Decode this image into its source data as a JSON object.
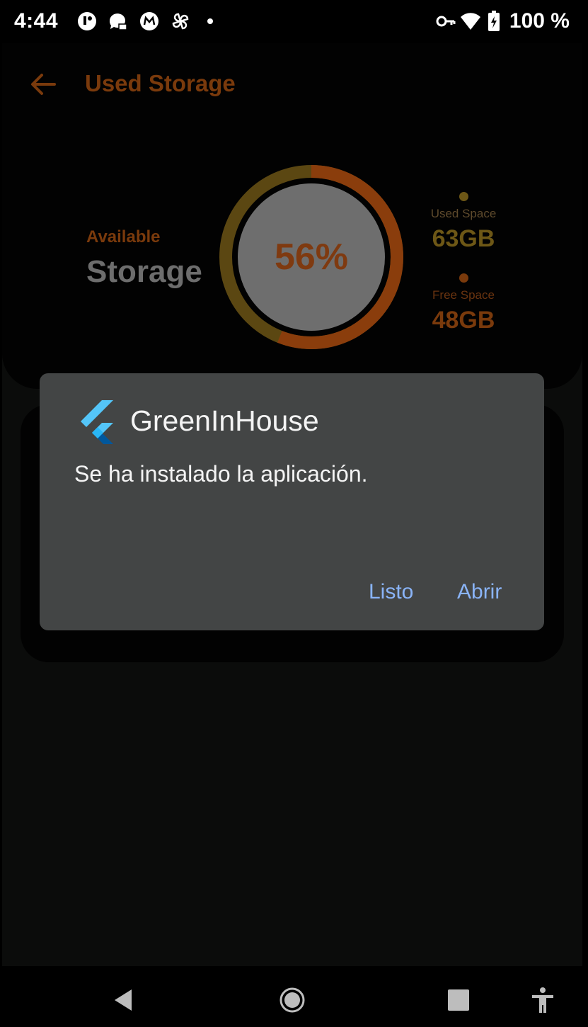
{
  "status_bar": {
    "time": "4:44",
    "battery": "100 %",
    "icons": [
      "notification-icon",
      "chat-icon",
      "mail-icon",
      "pinwheel-icon",
      "vpn-key-icon",
      "wifi-icon",
      "battery-charging-icon"
    ]
  },
  "app_bar": {
    "title": "Used Storage",
    "back_icon": "arrow-back-icon"
  },
  "storage": {
    "available_label": "Available",
    "storage_label": "Storage",
    "percent_text": "56%",
    "used_fraction": 0.56,
    "used_space_label": "Used Space",
    "used_space_value": "63GB",
    "free_space_label": "Free Space",
    "free_space_value": "48GB"
  },
  "dialog": {
    "app_name": "GreenInHouse",
    "message": "Se ha instalado la aplicación.",
    "button_done": "Listo",
    "button_open": "Abrir"
  },
  "nav_bar": {
    "icons": [
      "back-icon",
      "home-icon",
      "recents-icon",
      "accessibility-icon"
    ]
  },
  "colors": {
    "accent_orange": "#b84f10",
    "accent_gold": "#a98a1e",
    "dialog_bg": "#434545",
    "dialog_button": "#8ab4f8"
  }
}
